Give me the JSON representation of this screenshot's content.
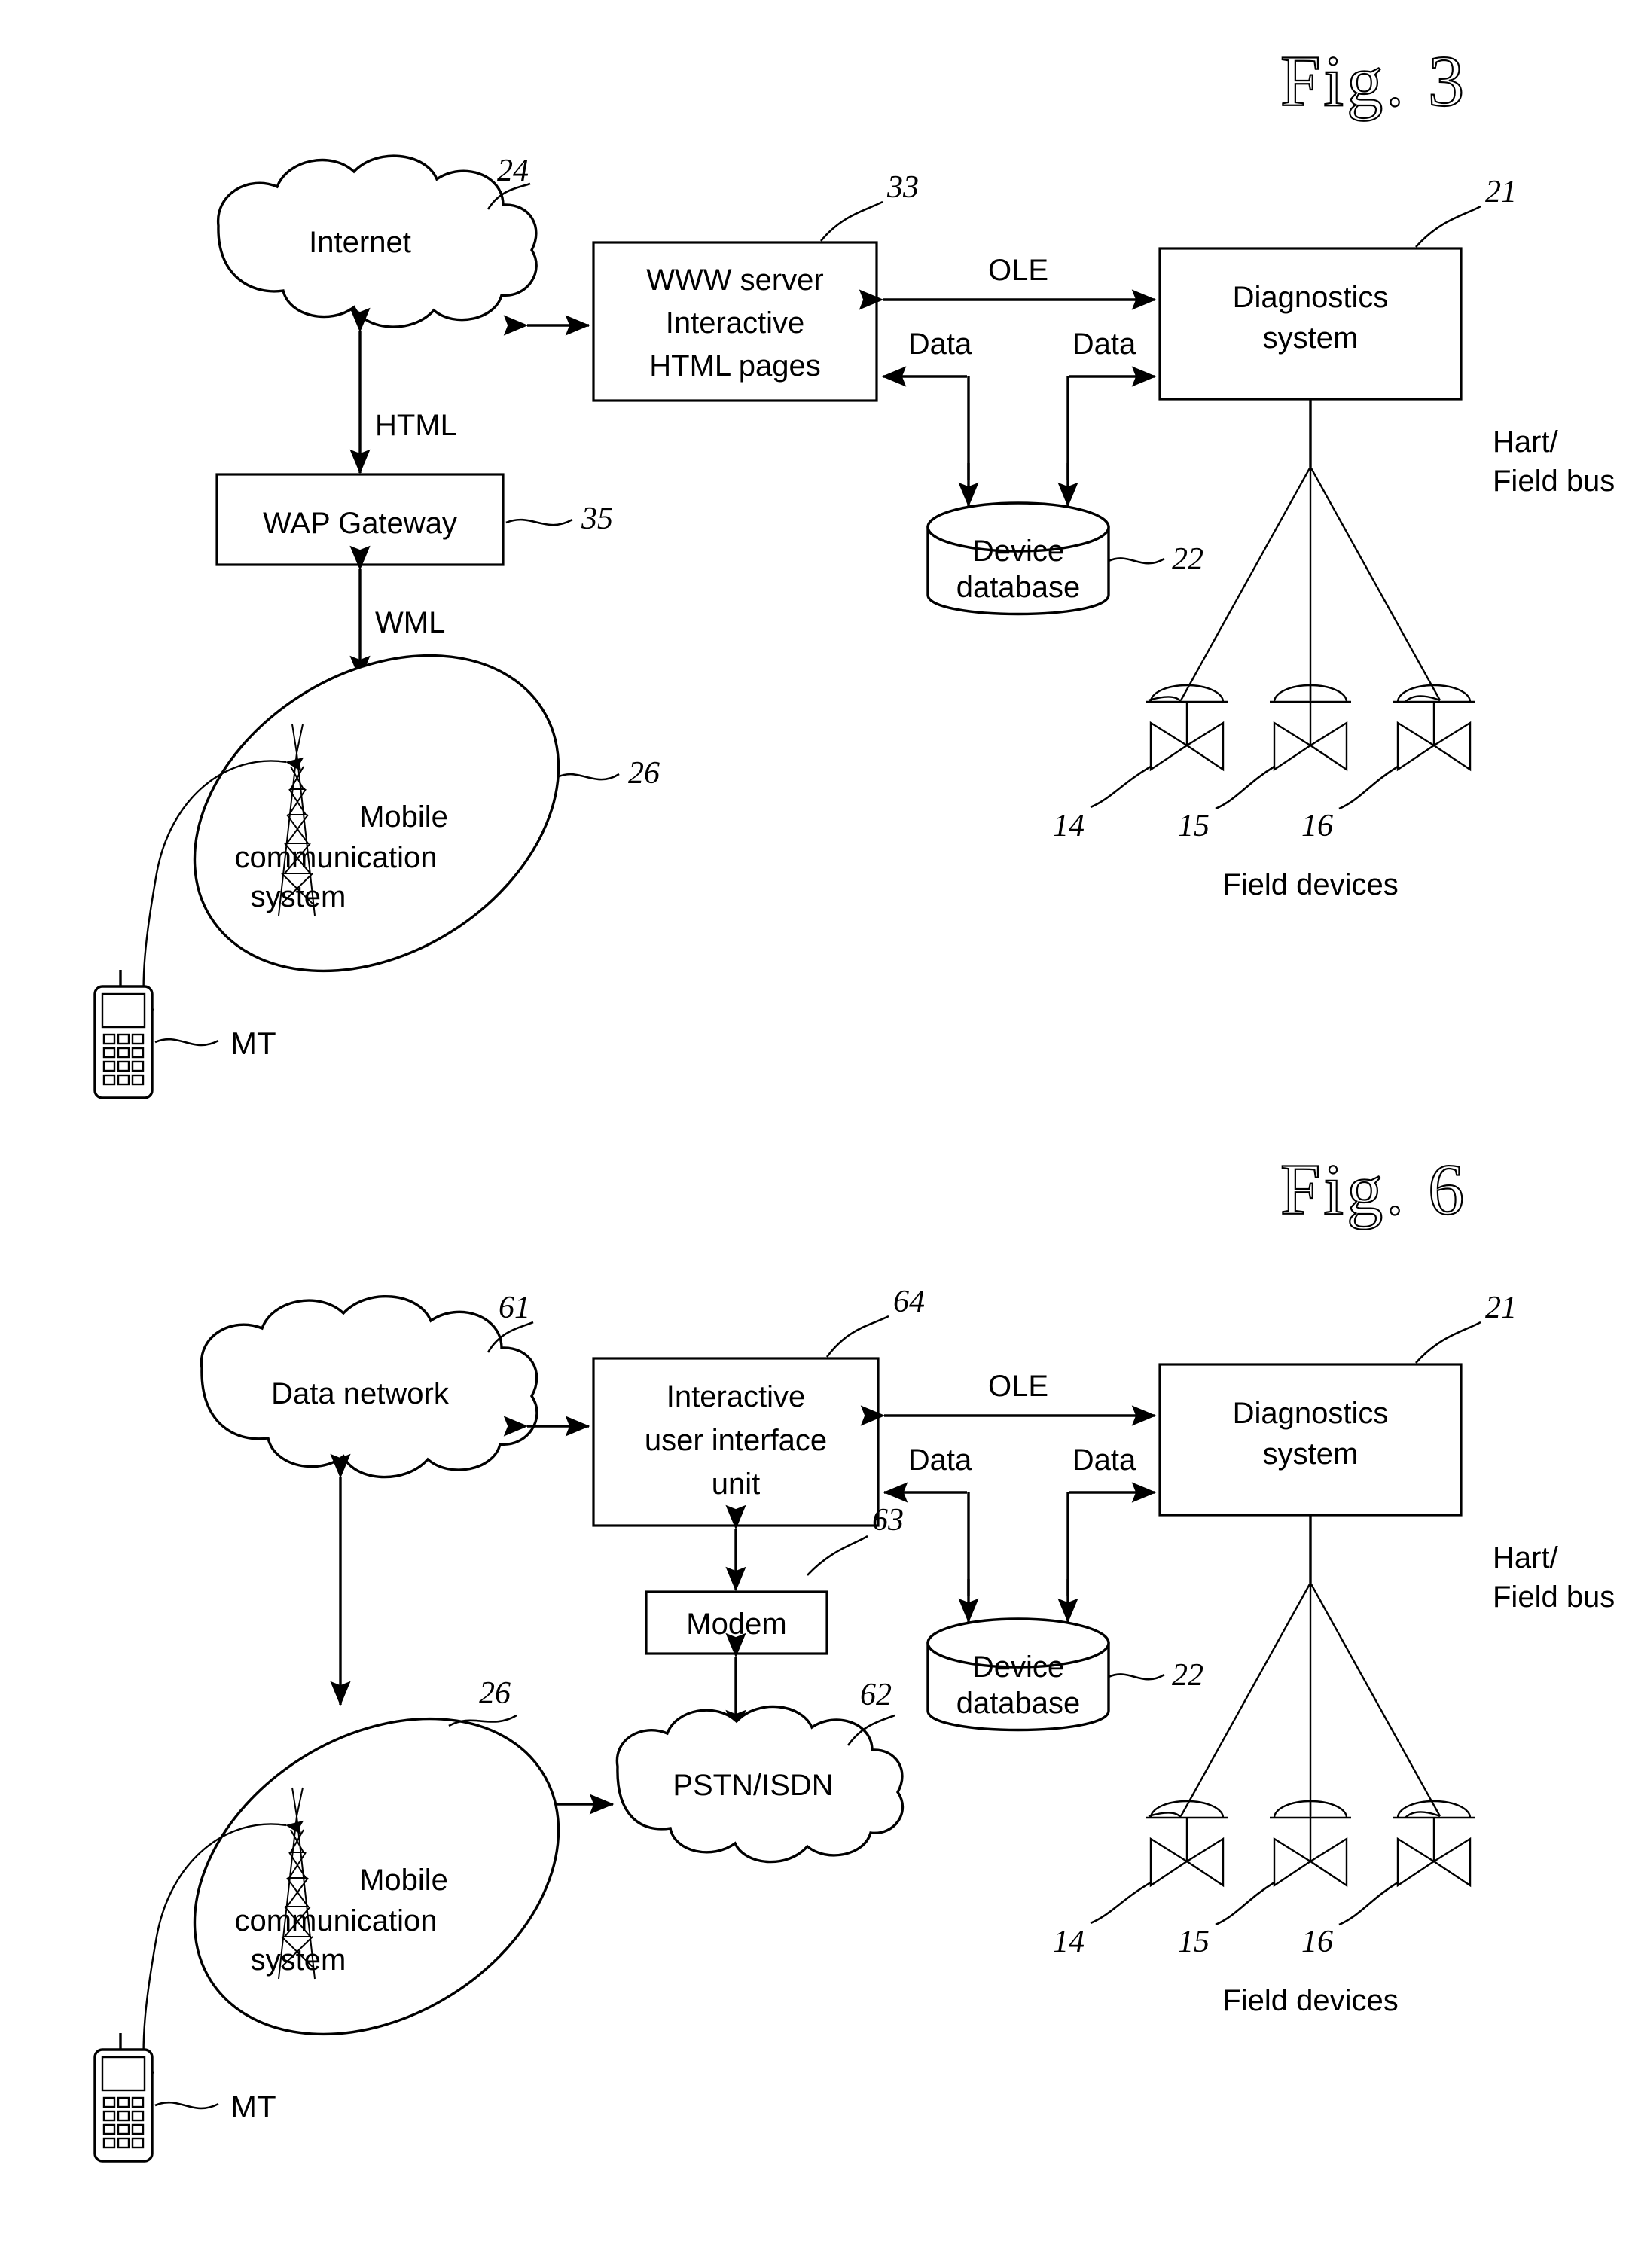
{
  "document": {
    "type": "patent-figure-sheet",
    "figures": [
      {
        "id": "fig3",
        "title": "Fig. 3",
        "nodes": {
          "internet": {
            "label": "Internet",
            "ref": "24",
            "shape": "cloud"
          },
          "www_server": {
            "label_line1": "WWW server",
            "label_line2": "Interactive",
            "label_line3": "HTML pages",
            "ref": "33",
            "shape": "rect"
          },
          "diagnostics": {
            "label_line1": "Diagnostics",
            "label_line2": "system",
            "ref": "21",
            "shape": "rect"
          },
          "device_database": {
            "label_line1": "Device",
            "label_line2": "database",
            "ref": "22",
            "shape": "cylinder"
          },
          "wap_gateway": {
            "label": "WAP Gateway",
            "ref": "35",
            "shape": "rect"
          },
          "mobile_system": {
            "label_line1": "Mobile",
            "label_line2": "communication",
            "label_line3": "system",
            "ref": "26",
            "shape": "ellipse"
          },
          "mobile_terminal": {
            "label": "MT",
            "shape": "handset"
          }
        },
        "link_labels": {
          "ole": "OLE",
          "data_left": "Data",
          "data_right": "Data",
          "html": "HTML",
          "wml": "WML",
          "bus": "Hart/\nField bus",
          "bus_line1": "Hart/",
          "bus_line2": "Field bus"
        },
        "field_devices": {
          "caption": "Field devices",
          "refs": [
            "14",
            "15",
            "16"
          ]
        }
      },
      {
        "id": "fig6",
        "title": "Fig. 6",
        "nodes": {
          "data_network": {
            "label": "Data network",
            "ref": "61",
            "shape": "cloud"
          },
          "iu_unit": {
            "label_line1": "Interactive",
            "label_line2": "user interface",
            "label_line3": "unit",
            "ref": "64",
            "shape": "rect"
          },
          "diagnostics": {
            "label_line1": "Diagnostics",
            "label_line2": "system",
            "ref": "21",
            "shape": "rect"
          },
          "device_database": {
            "label_line1": "Device",
            "label_line2": "database",
            "ref": "22",
            "shape": "cylinder"
          },
          "modem": {
            "label": "Modem",
            "ref": "63",
            "shape": "rect"
          },
          "pstn_isdn": {
            "label": "PSTN/ISDN",
            "ref": "62",
            "shape": "cloud"
          },
          "mobile_system": {
            "label_line1": "Mobile",
            "label_line2": "communication",
            "label_line3": "system",
            "ref": "26",
            "shape": "ellipse"
          },
          "mobile_terminal": {
            "label": "MT",
            "shape": "handset"
          }
        },
        "link_labels": {
          "ole": "OLE",
          "data_left": "Data",
          "data_right": "Data",
          "bus_line1": "Hart/",
          "bus_line2": "Field bus"
        },
        "field_devices": {
          "caption": "Field devices",
          "refs": [
            "14",
            "15",
            "16"
          ]
        }
      }
    ],
    "colors": {
      "ink": "#000000",
      "paper": "#ffffff"
    }
  }
}
